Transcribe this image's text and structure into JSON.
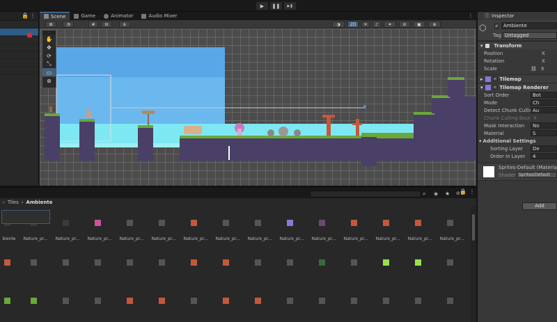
{
  "playbar": {
    "play": "▶",
    "pause": "❚❚",
    "step": "▶❚"
  },
  "scene_tabs": [
    {
      "label": "Scene"
    },
    {
      "label": "Game"
    },
    {
      "label": "Animator"
    },
    {
      "label": "Audio Mixer"
    }
  ],
  "scene_toolbar": {
    "mode_2d": "2D"
  },
  "project": {
    "breadcrumb_parent": "Tiles",
    "breadcrumb_current": "Ambiente",
    "asset_label": "Nature_pr...",
    "first_label": "biente",
    "count_badge": "5"
  },
  "inspector": {
    "tab": "Inspector",
    "object_name": "Ambiente",
    "tag_label": "Tag",
    "tag_value": "Untagged",
    "transform": {
      "title": "Transform",
      "position": "Position",
      "rotation": "Rotation",
      "scale": "Scale"
    },
    "tilemap": "Tilemap",
    "tilemap_renderer": {
      "title": "Tilemap Renderer",
      "sort_order": {
        "label": "Sort Order",
        "value": "Bot"
      },
      "mode": {
        "label": "Mode",
        "value": "Ch"
      },
      "detect_chunk": {
        "label": "Detect Chunk Culling Bounds",
        "value": "Au"
      },
      "chunk_bounds": {
        "label": "Chunk Culling Bounds",
        "value": ""
      },
      "mask": {
        "label": "Mask Interaction",
        "value": "No"
      },
      "material": {
        "label": "Material",
        "value": "S"
      },
      "additional": "Additional Settings",
      "sorting_layer": {
        "label": "Sorting Layer",
        "value": "De"
      },
      "order_in_layer": {
        "label": "Order in Layer",
        "value": "4"
      }
    },
    "material_name": "Sprites-Default (Materia",
    "shader_label": "Shader",
    "shader_value": "Sprites/Default",
    "add_button": "Add"
  },
  "colors": {
    "accent": "#4a90d9",
    "sky": "#5aa7e8",
    "water": "#7ee8f2",
    "ground": "#4a3f66",
    "grass": "#6aa83a"
  }
}
